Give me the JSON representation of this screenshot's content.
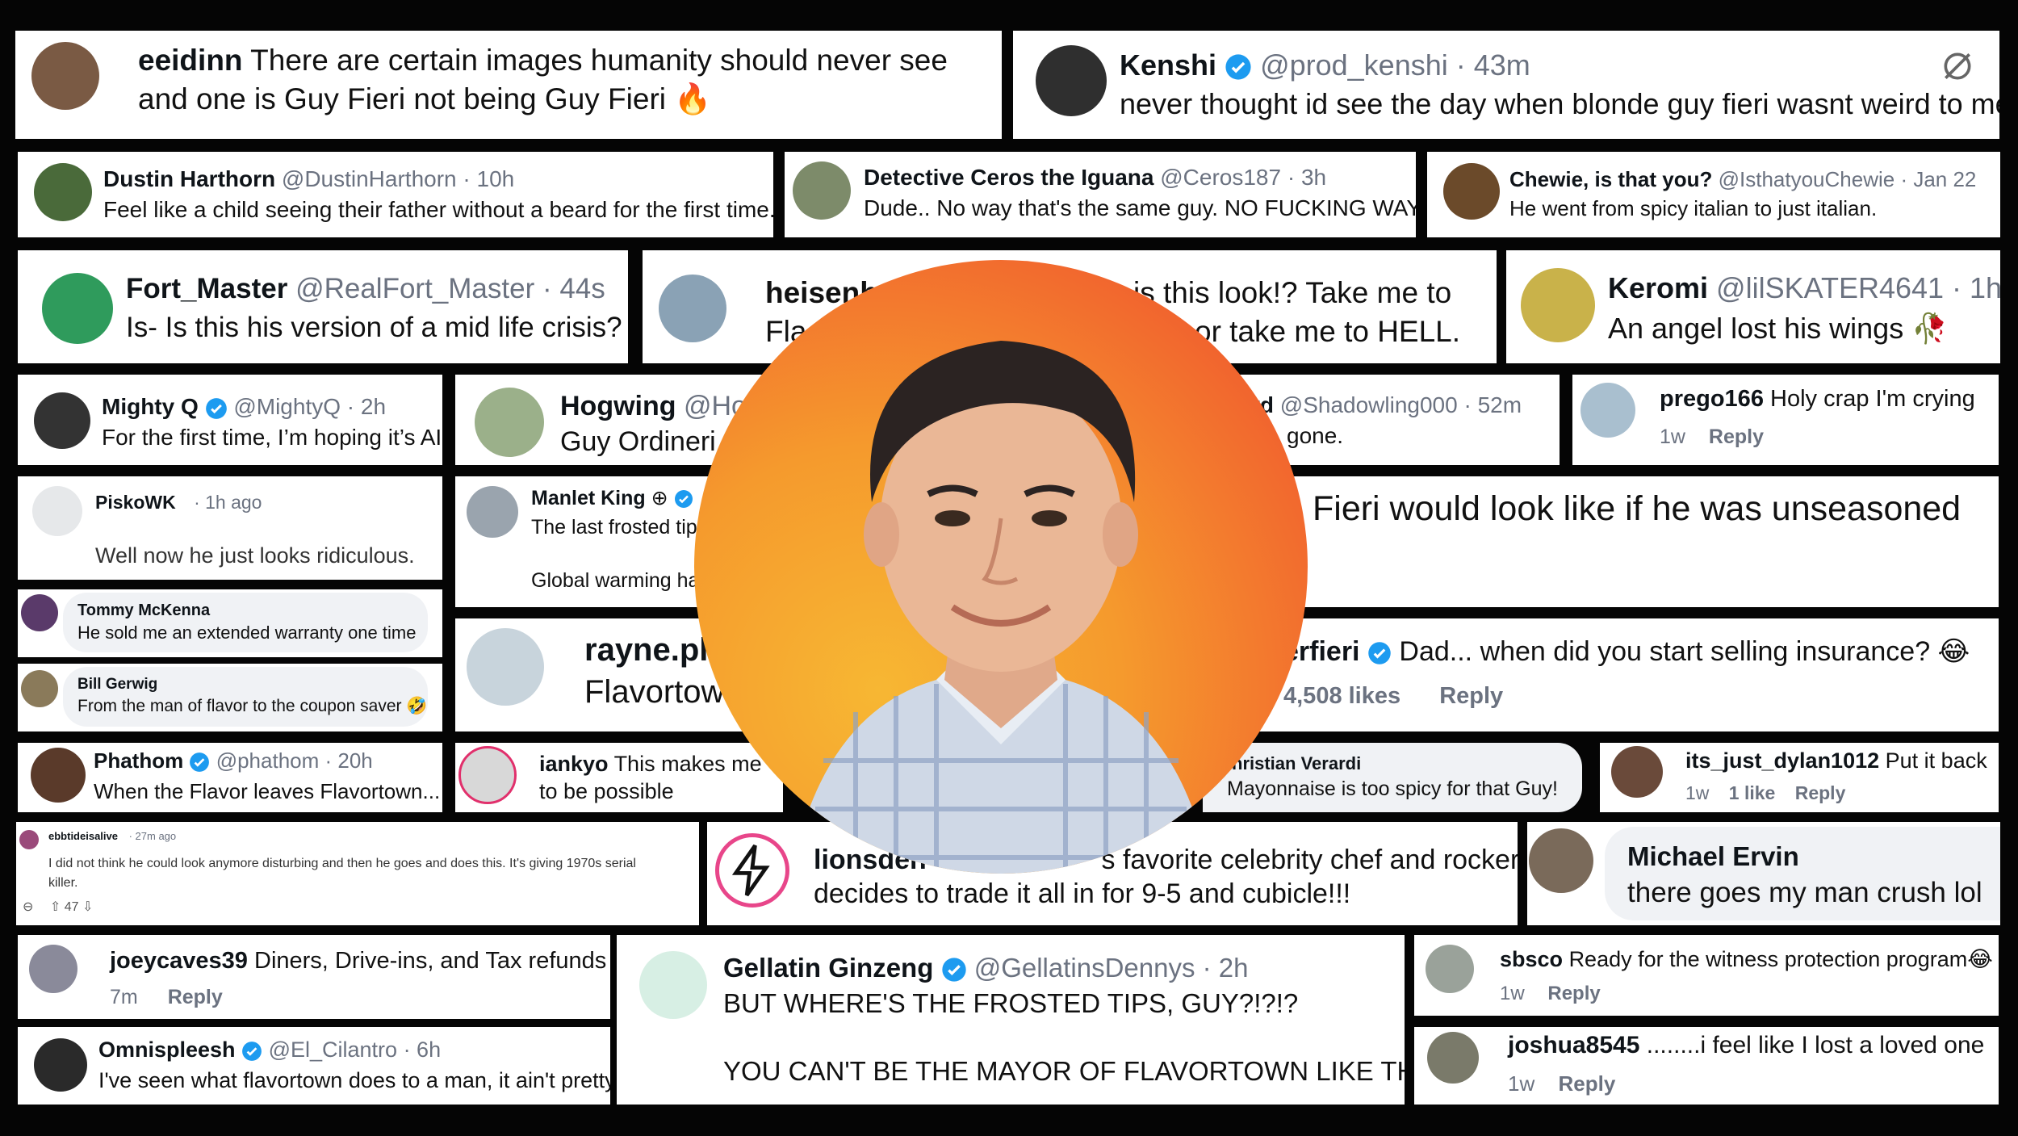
{
  "comments": {
    "c1": {
      "user": "eeidinn",
      "text_line1": "There are certain images humanity should never see",
      "text_line2": "and one is Guy Fieri not being Guy Fieri 🔥"
    },
    "c2": {
      "name": "Kenshi",
      "handle": "@prod_kenshi · 43m",
      "text": "never thought id see the day when blonde guy fieri wasnt weird to me"
    },
    "c3": {
      "name": "Dustin Harthorn",
      "handle": "@DustinHarthorn · 10h",
      "text": "Feel like a child seeing their father without a beard for the first time."
    },
    "c4": {
      "name": "Detective Ceros the Iguana",
      "handle": "@Ceros187 · 3h",
      "text": "Dude.. No way that's the same guy. NO FUCKING WAY"
    },
    "c5": {
      "name": "Chewie, is that you?",
      "handle": "@IsthatyouChewie · Jan 22",
      "text": "He went from spicy italian to just italian."
    },
    "c6": {
      "name": "Fort_Master",
      "handle": "@RealFort_Master · 44s",
      "text": "Is- Is this his version of a mid life crisis?"
    },
    "c7": {
      "name_visible": "heisenb",
      "text_l1": "is this look!? Take me to",
      "text_l1_prefix": "Fla",
      "text_l2": "or take me to HELL."
    },
    "c8": {
      "name": "Keromi",
      "handle": "@lilSKATER4641 · 1h",
      "text": "An angel lost his wings 🥀"
    },
    "c9": {
      "name": "Mighty Q",
      "handle": "@MightyQ · 2h",
      "text": "For the first time, I’m hoping it’s AI"
    },
    "c10": {
      "name": "Hogwing",
      "handle": "@Hog",
      "text": "Guy Ordineri"
    },
    "c11": {
      "name_frag": "rd",
      "handle": "@Shadowling000 · 52m",
      "text": "gone."
    },
    "c12": {
      "user": "prego166",
      "text": "Holy crap I'm crying",
      "time": "1w",
      "reply": "Reply"
    },
    "c13": {
      "user": "PiskoWK",
      "time": "· 1h ago",
      "text": "Well now he just looks ridiculous."
    },
    "c14": {
      "name": "Manlet King",
      "suffix": "⊕",
      "text1": "The last frosted tip",
      "text2": "Global warming ha"
    },
    "c15": {
      "text": "Fieri would look like if he was unseasoned"
    },
    "c16": {
      "name": "Tommy McKenna",
      "text": "He sold me an extended warranty one time"
    },
    "c17": {
      "name": "Bill Gerwig",
      "text": "From the man of flavor to the coupon saver 🤣"
    },
    "c18": {
      "name": "rayne.pl",
      "text": "Flavortow"
    },
    "c19": {
      "user_frag": "erfieri",
      "text": "Dad... when did you start selling insurance? 😂",
      "likes": "4,508 likes",
      "reply": "Reply"
    },
    "c20": {
      "name": "Phathom",
      "handle": "@phathom · 20h",
      "text": "When the Flavor leaves Flavortown..."
    },
    "c21": {
      "user": "iankyo",
      "text1": "This makes me",
      "text2": "to be possible"
    },
    "c22": {
      "name": "hristian Verardi",
      "text": "Mayonnaise is too spicy for that Guy!"
    },
    "c23": {
      "user": "its_just_dylan1012",
      "text": "Put it back",
      "time": "1w",
      "likes": "1 like",
      "reply": "Reply"
    },
    "c24": {
      "user": "ebbtideisalive",
      "time": "· 27m ago",
      "text1": "I did not think he could look anymore disturbing and then he goes and does this. It's giving 1970s serial",
      "text2": "killer.",
      "votes": "47"
    },
    "c25": {
      "user": "lionsden",
      "text1": "'s favorite celebrity chef and rocker",
      "text2": "decides to trade it all in for 9-5 and cubicle!!!"
    },
    "c26": {
      "name": "Michael Ervin",
      "text": "there goes my man crush lol"
    },
    "c27": {
      "user": "joeycaves39",
      "text": "Diners, Drive-ins, and Tax refunds",
      "time": "7m",
      "reply": "Reply"
    },
    "c28": {
      "name": "Gellatin Ginzeng",
      "handle": "@GellatinsDennys · 2h",
      "text1": "BUT WHERE'S THE FROSTED TIPS, GUY?!?!?",
      "text2": "YOU CAN'T BE THE MAYOR OF FLAVORTOWN LIKE THIS"
    },
    "c29": {
      "user": "sbsco",
      "text": "Ready for the witness protection program😂",
      "time": "1w",
      "reply": "Reply"
    },
    "c30": {
      "name": "Omnispleesh",
      "handle": "@El_Cilantro · 6h",
      "text": "I've seen what flavortown does to a man, it ain't pretty."
    },
    "c31": {
      "user": "joshua8545",
      "text": "........i feel like I lost a loved one",
      "time": "1w",
      "reply": "Reply"
    }
  },
  "colors": {
    "verified": "#1d9bf0",
    "background": "#050505",
    "gradient_start": "#f7b733",
    "gradient_end": "#e9462a"
  }
}
